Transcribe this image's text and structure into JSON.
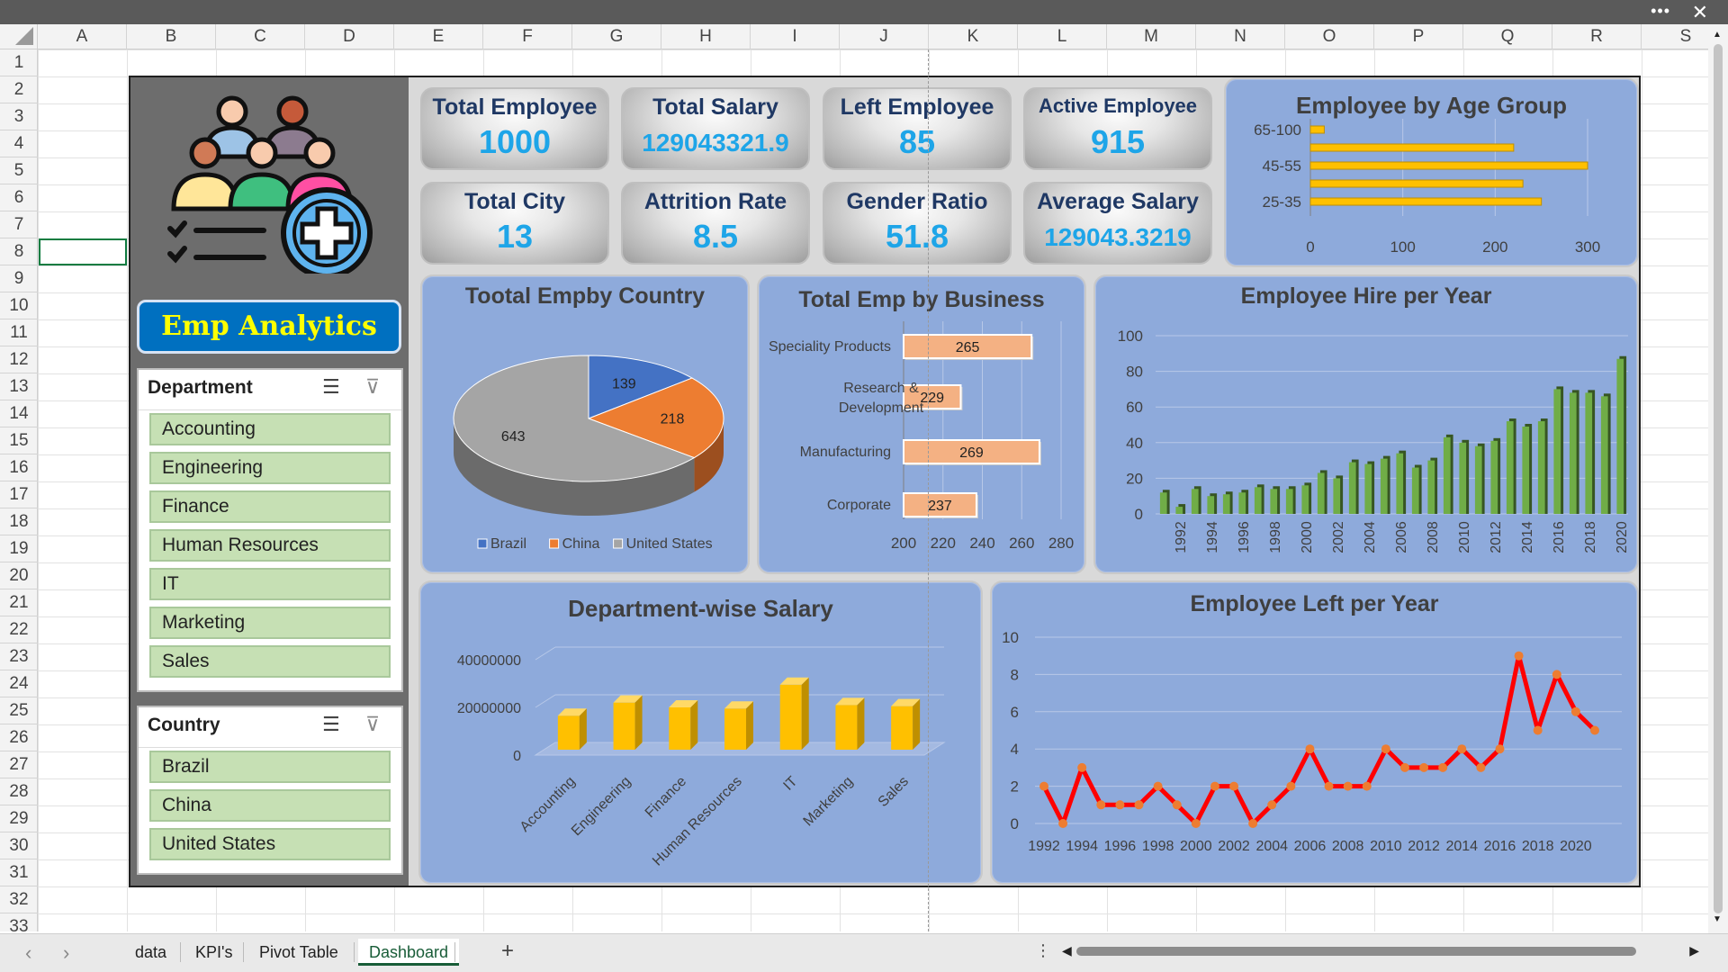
{
  "window": {
    "more_icon": "more-icon",
    "close_icon": "close-icon"
  },
  "columns": [
    "A",
    "B",
    "C",
    "D",
    "E",
    "F",
    "G",
    "H",
    "I",
    "J",
    "K",
    "L",
    "M",
    "N",
    "O",
    "P",
    "Q",
    "R",
    "S"
  ],
  "rows": [
    "1",
    "2",
    "3",
    "4",
    "5",
    "6",
    "7",
    "8",
    "9",
    "10",
    "11",
    "12",
    "13",
    "14",
    "15",
    "16",
    "17",
    "18",
    "19",
    "20",
    "21",
    "22",
    "23",
    "24",
    "25",
    "26",
    "27",
    "28",
    "29",
    "30",
    "31",
    "32",
    "33"
  ],
  "kpis": [
    {
      "label": "Total Employee",
      "value": "1000"
    },
    {
      "label": "Total Salary",
      "value": "129043321.9"
    },
    {
      "label": "Left Employee",
      "value": "85"
    },
    {
      "label": "Active Employee",
      "value": "915"
    },
    {
      "label": "Total City",
      "value": "13"
    },
    {
      "label": "Attrition Rate",
      "value": "8.5"
    },
    {
      "label": "Gender Ratio",
      "value": "51.8"
    },
    {
      "label": "Average Salary",
      "value": "129043.3219"
    }
  ],
  "app_title": "Emp Analytics",
  "department_slicer": {
    "header": "Department",
    "items": [
      "Accounting",
      "Engineering",
      "Finance",
      "Human Resources",
      "IT",
      "Marketing",
      "Sales"
    ]
  },
  "country_slicer": {
    "header": "Country",
    "items": [
      "Brazil",
      "China",
      "United States"
    ]
  },
  "sheet_tabs": [
    "data",
    "KPI's",
    "Pivot Table",
    "Dashboard"
  ],
  "active_tab": "Dashboard",
  "add_sheet": "+",
  "colors": {
    "panel_bg": "#8eaadb",
    "kpi_value": "#1ea5e8",
    "kpi_label": "#1f3864",
    "bar_orange": "#f4b183",
    "bar_gold": "#ffc000",
    "bar_green": "#548235",
    "line_red": "#ff0000",
    "marker_orange": "#ed7d31",
    "pie_blue": "#4472c4",
    "pie_orange": "#ed7d31",
    "pie_gray": "#a5a5a5",
    "slicer_item": "#c6e0b4",
    "title_bg": "#0070c0",
    "title_text": "#ffff00"
  },
  "chart_data": [
    {
      "id": "age",
      "type": "bar",
      "orientation": "horizontal",
      "title": "Employee by Age Group",
      "categories": [
        "65-100",
        "",
        "45-55",
        "",
        "25-35"
      ],
      "values": [
        15,
        220,
        300,
        230,
        250
      ],
      "xlim": [
        0,
        300
      ],
      "xticks": [
        "0",
        "100",
        "200",
        "300"
      ]
    },
    {
      "id": "country",
      "type": "pie",
      "title": "Tootal Empby Country",
      "labels": [
        "Brazil",
        "China",
        "United States"
      ],
      "values": [
        139,
        218,
        643
      ]
    },
    {
      "id": "business",
      "type": "bar",
      "orientation": "horizontal",
      "title": "Total Emp by Business",
      "categories": [
        "Speciality Products",
        "Research & Development",
        "Manufacturing",
        "Corporate"
      ],
      "values": [
        265,
        229,
        269,
        237
      ],
      "xlim": [
        200,
        280
      ],
      "xticks": [
        "200",
        "220",
        "240",
        "260",
        "280"
      ]
    },
    {
      "id": "hire",
      "type": "bar",
      "title": "Employee Hire per Year",
      "x": [
        1992,
        1993,
        1994,
        1995,
        1996,
        1997,
        1998,
        1999,
        2000,
        2001,
        2002,
        2003,
        2004,
        2005,
        2006,
        2007,
        2008,
        2009,
        2010,
        2011,
        2012,
        2013,
        2014,
        2015,
        2016,
        2017,
        2018,
        2019,
        2020,
        2021
      ],
      "values": [
        12,
        4,
        14,
        10,
        11,
        12,
        15,
        14,
        14,
        16,
        23,
        20,
        29,
        28,
        31,
        34,
        26,
        30,
        43,
        40,
        38,
        41,
        52,
        49,
        52,
        70,
        68,
        68,
        66,
        87
      ],
      "ylim": [
        0,
        100
      ],
      "yticks": [
        "0",
        "20",
        "40",
        "60",
        "80",
        "100"
      ],
      "xticks": [
        "1992",
        "1994",
        "1996",
        "1998",
        "2000",
        "2002",
        "2004",
        "2006",
        "2008",
        "2010",
        "2012",
        "2014",
        "2016",
        "2018",
        "2020"
      ]
    },
    {
      "id": "deptsal",
      "type": "bar",
      "title": "Department-wise Salary",
      "categories": [
        "Accounting",
        "Engineering",
        "Finance",
        "Human Resources",
        "IT",
        "Marketing",
        "Sales"
      ],
      "values": [
        15000000,
        20500000,
        18500000,
        18000000,
        28000000,
        19500000,
        19000000
      ],
      "ylim": [
        0,
        40000000
      ],
      "yticks": [
        "0",
        "20000000",
        "40000000"
      ]
    },
    {
      "id": "left",
      "type": "line",
      "title": "Employee Left per Year",
      "x": [
        1992,
        1993,
        1994,
        1995,
        1996,
        1997,
        1998,
        1999,
        2000,
        2001,
        2002,
        2003,
        2004,
        2005,
        2006,
        2007,
        2008,
        2009,
        2010,
        2011,
        2012,
        2013,
        2014,
        2015,
        2016,
        2017,
        2018,
        2019,
        2020,
        2021
      ],
      "values": [
        2,
        0,
        3,
        1,
        1,
        1,
        2,
        1,
        0,
        2,
        2,
        0,
        1,
        2,
        4,
        2,
        2,
        2,
        4,
        3,
        3,
        3,
        4,
        3,
        4,
        9,
        5,
        8,
        6,
        5
      ],
      "ylim": [
        0,
        10
      ],
      "yticks": [
        "0",
        "2",
        "4",
        "6",
        "8",
        "10"
      ],
      "xticks": [
        "1992",
        "1994",
        "1996",
        "1998",
        "2000",
        "2002",
        "2004",
        "2006",
        "2008",
        "2010",
        "2012",
        "2014",
        "2016",
        "2018",
        "2020"
      ]
    }
  ]
}
